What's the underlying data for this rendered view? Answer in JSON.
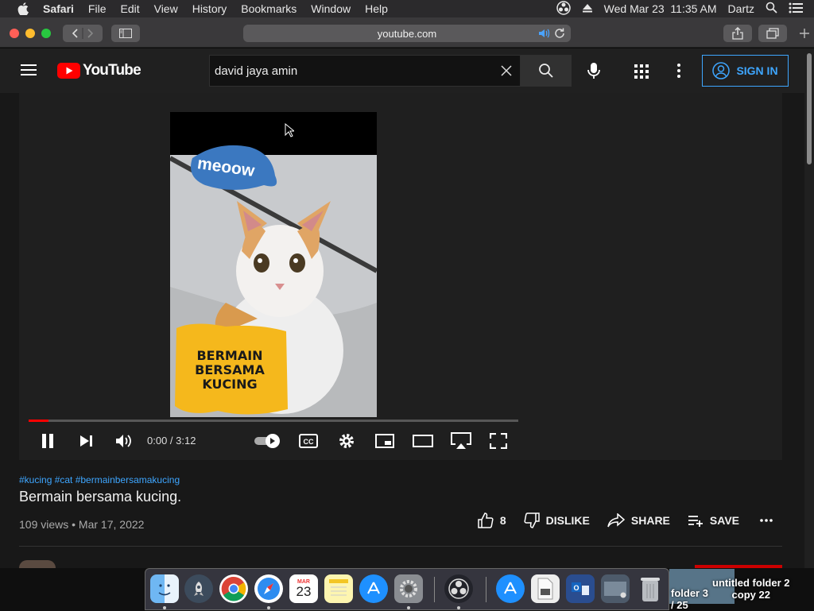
{
  "menubar": {
    "app": "Safari",
    "items": [
      "File",
      "Edit",
      "View",
      "History",
      "Bookmarks",
      "Window",
      "Help"
    ],
    "datetime": "Wed Mar 23  11:35 AM",
    "user": "Dartz"
  },
  "safari": {
    "url": "youtube.com"
  },
  "youtube": {
    "logo_text": "YouTube",
    "search_value": "david jaya amin",
    "signin_label": "SIGN IN"
  },
  "video": {
    "sticker_top": "meoow",
    "caption_line1": "BERMAIN",
    "caption_line2": "BERSAMA",
    "caption_line3": "KUCING",
    "time": "0:00 / 3:12",
    "progress_fraction": 0.04
  },
  "info": {
    "hashtags": "#kucing #cat #bermainbersamakucing",
    "title": "Bermain bersama kucing.",
    "meta": "109 views • Mar 17, 2022",
    "like_count": "8",
    "dislike_label": "DISLIKE",
    "share_label": "SHARE",
    "save_label": "SAVE"
  },
  "desktop": {
    "label1_line1": "untitled folder 2",
    "label1_line2": "copy 22",
    "label2_line1": "folder 3",
    "label2_line2": "/ 25"
  },
  "dock": {
    "calendar_month": "MAR",
    "calendar_day": "23"
  },
  "colors": {
    "accent_blue": "#3ea6ff",
    "youtube_red": "#ff0000",
    "caption_yellow": "#f5b81c"
  }
}
